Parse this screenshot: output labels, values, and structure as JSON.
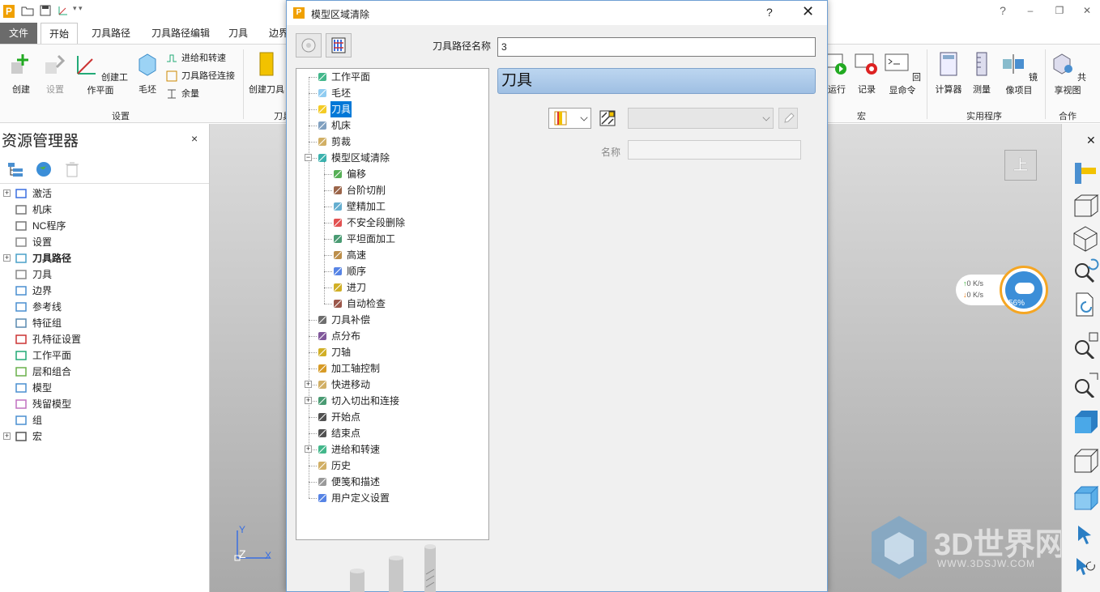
{
  "ribbon": {
    "tabs": [
      "文件",
      "开始",
      "刀具路径",
      "刀具路径编辑",
      "刀具",
      "边界"
    ],
    "active_tab": "开始",
    "buttons": {
      "create": "创建",
      "settings": "设置",
      "create_workplane": "创建工作平面",
      "blank": "毛坯",
      "feed_rate": "进给和转速",
      "toolpath_connect": "刀具路径连接",
      "allowance": "余量",
      "create_tool": "创建刀具",
      "run": "运行",
      "record": "记录",
      "echo_command": "回显命令",
      "calculator": "计算器",
      "measure": "测量",
      "mirror_item": "镜像项目",
      "share_view": "共享视图"
    },
    "groups": {
      "setup": "设置",
      "tool_group": "刀具",
      "macro": "宏",
      "utilities": "实用程序",
      "collaborate": "合作"
    }
  },
  "explorer": {
    "title": "资源管理器",
    "close": "×",
    "items": [
      {
        "label": "激活",
        "expand": true,
        "bold": false
      },
      {
        "label": "机床",
        "expand": false,
        "bold": false
      },
      {
        "label": "NC程序",
        "expand": false,
        "bold": false
      },
      {
        "label": "设置",
        "expand": false,
        "bold": false
      },
      {
        "label": "刀具路径",
        "expand": true,
        "bold": true
      },
      {
        "label": "刀具",
        "expand": false,
        "bold": false
      },
      {
        "label": "边界",
        "expand": false,
        "bold": false
      },
      {
        "label": "参考线",
        "expand": false,
        "bold": false
      },
      {
        "label": "特征组",
        "expand": false,
        "bold": false
      },
      {
        "label": "孔特征设置",
        "expand": false,
        "bold": false
      },
      {
        "label": "工作平面",
        "expand": false,
        "bold": false
      },
      {
        "label": "层和组合",
        "expand": false,
        "bold": false
      },
      {
        "label": "模型",
        "expand": false,
        "bold": false
      },
      {
        "label": "残留模型",
        "expand": false,
        "bold": false
      },
      {
        "label": "组",
        "expand": false,
        "bold": false
      },
      {
        "label": "宏",
        "expand": true,
        "bold": false
      }
    ]
  },
  "viewport": {
    "view_button": "上",
    "net_up": "0   K/s",
    "net_down": "0   K/s",
    "percent": "56%",
    "axis_y": "Y",
    "axis_z": "Z",
    "axis_x": "X",
    "watermark_main": "3D世界网",
    "watermark_url": "WWW.3DSJW.COM"
  },
  "dialog": {
    "title": "模型区域清除",
    "help": "?",
    "close": "✕",
    "toolpath_name_label": "刀具路径名称",
    "toolpath_name_value": "3",
    "section_title": "刀具",
    "name_label": "名称",
    "name_value": "",
    "tree": [
      {
        "label": "工作平面",
        "level": 0,
        "expand": false,
        "selected": false,
        "icon": "workplane"
      },
      {
        "label": "毛坯",
        "level": 0,
        "expand": false,
        "selected": false,
        "icon": "blank"
      },
      {
        "label": "刀具",
        "level": 0,
        "expand": false,
        "selected": true,
        "icon": "tool"
      },
      {
        "label": "机床",
        "level": 0,
        "expand": false,
        "selected": false,
        "icon": "machine"
      },
      {
        "label": "剪裁",
        "level": 0,
        "expand": false,
        "selected": false,
        "icon": "trim"
      },
      {
        "label": "模型区域清除",
        "level": 0,
        "expand": "minus",
        "selected": false,
        "icon": "area-clear"
      },
      {
        "label": "偏移",
        "level": 1,
        "expand": false,
        "selected": false,
        "icon": "offset"
      },
      {
        "label": "台阶切削",
        "level": 1,
        "expand": false,
        "selected": false,
        "icon": "step"
      },
      {
        "label": "壁精加工",
        "level": 1,
        "expand": false,
        "selected": false,
        "icon": "wall"
      },
      {
        "label": "不安全段删除",
        "level": 1,
        "expand": false,
        "selected": false,
        "icon": "unsafe"
      },
      {
        "label": "平坦面加工",
        "level": 1,
        "expand": false,
        "selected": false,
        "icon": "flat"
      },
      {
        "label": "高速",
        "level": 1,
        "expand": false,
        "selected": false,
        "icon": "highspeed"
      },
      {
        "label": "顺序",
        "level": 1,
        "expand": false,
        "selected": false,
        "icon": "order"
      },
      {
        "label": "进刀",
        "level": 1,
        "expand": false,
        "selected": false,
        "icon": "leadin"
      },
      {
        "label": "自动检查",
        "level": 1,
        "expand": false,
        "selected": false,
        "icon": "autocheck"
      },
      {
        "label": "刀具补偿",
        "level": 0,
        "expand": false,
        "selected": false,
        "icon": "toolcomp"
      },
      {
        "label": "点分布",
        "level": 0,
        "expand": false,
        "selected": false,
        "icon": "points"
      },
      {
        "label": "刀轴",
        "level": 0,
        "expand": false,
        "selected": false,
        "icon": "toolaxis"
      },
      {
        "label": "加工轴控制",
        "level": 0,
        "expand": false,
        "selected": false,
        "icon": "axiscontrol"
      },
      {
        "label": "快进移动",
        "level": 0,
        "expand": "plus",
        "selected": false,
        "icon": "rapid"
      },
      {
        "label": "切入切出和连接",
        "level": 0,
        "expand": "plus",
        "selected": false,
        "icon": "leads"
      },
      {
        "label": "开始点",
        "level": 0,
        "expand": false,
        "selected": false,
        "icon": "startpt"
      },
      {
        "label": "结束点",
        "level": 0,
        "expand": false,
        "selected": false,
        "icon": "endpt"
      },
      {
        "label": "进给和转速",
        "level": 0,
        "expand": "plus",
        "selected": false,
        "icon": "feed"
      },
      {
        "label": "历史",
        "level": 0,
        "expand": false,
        "selected": false,
        "icon": "history"
      },
      {
        "label": "便笺和描述",
        "level": 0,
        "expand": false,
        "selected": false,
        "icon": "notes"
      },
      {
        "label": "用户定义设置",
        "level": 0,
        "expand": false,
        "selected": false,
        "icon": "user"
      }
    ]
  }
}
